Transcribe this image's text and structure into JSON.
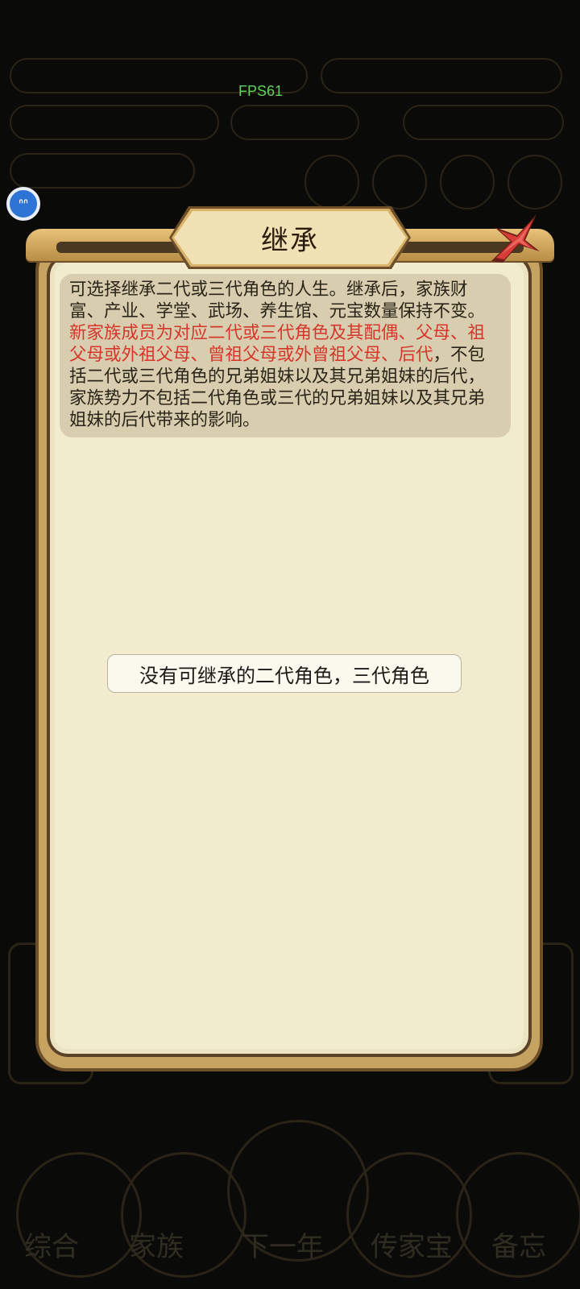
{
  "overlay": {
    "fps_label": "FPS61"
  },
  "dialog": {
    "title": "继承",
    "description": {
      "part1": "可选择继承二代或三代角色的人生。继承后，家族财富、产业、学堂、武场、养生馆、元宝数量保持不变。",
      "highlight": "新家族成员为对应二代或三代角色及其配偶、父母、祖父母或外祖父母、曾祖父母或外曾祖父母、后代",
      "part2": "，不包括二代或三代角色的兄弟姐妹以及其兄弟姐妹的后代，家族势力不包括二代角色或三代的兄弟姐妹以及其兄弟姐妹的后代带来的影响。"
    },
    "empty_message": "没有可继承的二代角色，三代角色"
  },
  "background_ui": {
    "bottom_tabs": [
      "综合",
      "家族",
      "下一年",
      "传家宝",
      "备忘"
    ]
  },
  "colors": {
    "highlight_text": "#d6362a",
    "fps_green": "#5fd45f",
    "dialog_paper": "#f2ecce",
    "frame_gold": "#c6a360"
  }
}
